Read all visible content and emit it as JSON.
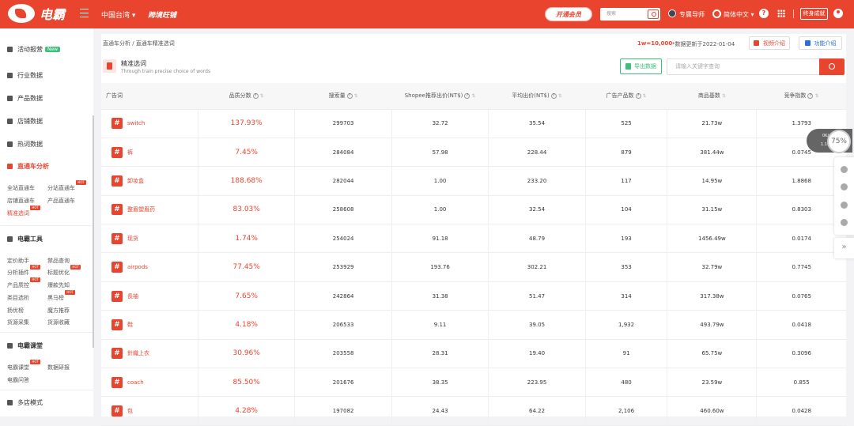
{
  "topbar": {
    "logo_text": "电霸",
    "region": "中国台湾 ▾",
    "brand_tag": "跨境旺铺",
    "vip_button": "开通会员",
    "search_placeholder": "搜索",
    "mentor": "专属导师",
    "language": "简体中文 ▾",
    "help": "?",
    "member_button": "终身成就"
  },
  "sidebar": {
    "items": [
      {
        "label": "活动报营",
        "badge": "New"
      },
      {
        "label": "行业数据"
      },
      {
        "label": "产品数据"
      },
      {
        "label": "店铺数据"
      },
      {
        "label": "热词数据"
      },
      {
        "label": "直通车分析"
      }
    ],
    "sub1": [
      "全站直通车",
      "分站直通车",
      "店铺直通车",
      "产品直通车",
      "精准选词"
    ],
    "tools_title": "电霸工具",
    "tools": [
      "定价助手",
      "禁品查询",
      "分析插件",
      "标题优化",
      "产品质控",
      "爆款先知",
      "类目选析",
      "黑马榜",
      "扬优榜",
      "魔方推荐",
      "货源采集",
      "货源收藏"
    ],
    "class_title": "电霸课堂",
    "class": [
      "电霸课堂",
      "数据研报",
      "电霸问答"
    ],
    "multi_title": "多店模式",
    "hot": "HOT"
  },
  "main": {
    "breadcrumb": "直通车分析 / 直通车精准选词",
    "rate": "1w=10,000",
    "update": "*数据更新于2022-01-04",
    "video_btn": "视频介绍",
    "func_btn": "功能介绍",
    "title": "精准选词",
    "subtitle": "Through train precise choice of words",
    "export_btn": "导出数据",
    "kw_placeholder": "请输入关键字查询"
  },
  "table": {
    "headers": [
      "广告词",
      "品质分数",
      "搜索量",
      "Shopee推荐出价(NT$)",
      "平均出价(NT$)",
      "广告产品数",
      "商品基数",
      "竞争指数"
    ],
    "rows": [
      [
        "switch",
        "137.93%",
        "299703",
        "32.72",
        "35.54",
        "525",
        "21.73w",
        "1.3793"
      ],
      [
        "裤",
        "7.45%",
        "284084",
        "57.98",
        "228.44",
        "879",
        "381.44w",
        "0.0745"
      ],
      [
        "卸妆盒",
        "188.68%",
        "282044",
        "1.00",
        "233.20",
        "117",
        "14.95w",
        "1.8868"
      ],
      [
        "整眉塑眉药",
        "83.03%",
        "258608",
        "1.00",
        "32.54",
        "104",
        "31.15w",
        "0.8303"
      ],
      [
        "现货",
        "1.74%",
        "254024",
        "91.18",
        "48.79",
        "193",
        "1456.49w",
        "0.0174"
      ],
      [
        "airpods",
        "77.45%",
        "253929",
        "193.76",
        "302.21",
        "353",
        "32.79w",
        "0.7745"
      ],
      [
        "長袖",
        "7.65%",
        "242864",
        "31.38",
        "51.47",
        "314",
        "317.38w",
        "0.0765"
      ],
      [
        "鞋",
        "4.18%",
        "206533",
        "9.11",
        "39.05",
        "1,932",
        "493.79w",
        "0.0418"
      ],
      [
        "針織上衣",
        "30.96%",
        "203558",
        "28.31",
        "19.40",
        "91",
        "65.75w",
        "0.3096"
      ],
      [
        "coach",
        "85.50%",
        "201676",
        "38.35",
        "223.95",
        "480",
        "23.59w",
        "0.855"
      ],
      [
        "包",
        "4.28%",
        "197082",
        "24.43",
        "64.22",
        "2,106",
        "460.60w",
        "0.0428"
      ]
    ]
  },
  "widget": {
    "percent": "75%",
    "up": "0K/s",
    "down": "1.1K/s"
  }
}
